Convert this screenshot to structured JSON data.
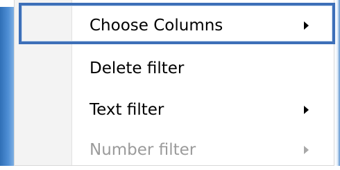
{
  "context_menu": {
    "items": [
      {
        "label": "Choose Columns",
        "has_submenu": true,
        "disabled": false,
        "highlighted": true
      },
      {
        "label": "Delete filter",
        "has_submenu": false,
        "disabled": false,
        "highlighted": false
      },
      {
        "label": "Text filter",
        "has_submenu": true,
        "disabled": false,
        "highlighted": false
      },
      {
        "label": "Number filter",
        "has_submenu": true,
        "disabled": true,
        "highlighted": false
      }
    ],
    "colors": {
      "highlight_border": "#3d6fb8",
      "disabled_text": "#9b9b9b",
      "text": "#000000"
    },
    "icons": {
      "submenu_arrow": "chevron-right-icon"
    }
  }
}
